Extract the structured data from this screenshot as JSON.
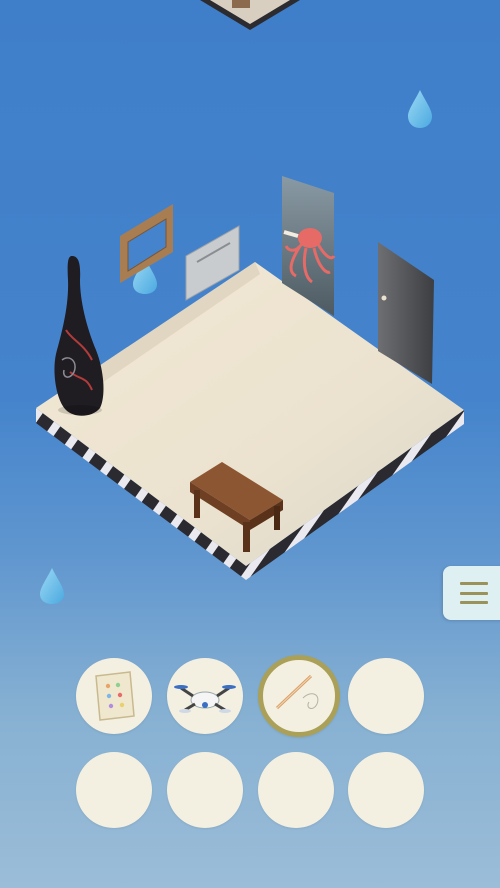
{
  "scene": {
    "background_top": "#3f7ec9",
    "background_bottom": "#9bbdd8",
    "items": [
      "vase",
      "frame",
      "vent",
      "octopus-poster",
      "door",
      "table",
      "water-drop"
    ]
  },
  "menu": {
    "icon": "hamburger-menu-icon",
    "color": "#9a9258"
  },
  "inventory": {
    "selected_index": 2,
    "slots": [
      {
        "item": "tablet-icon"
      },
      {
        "item": "drone-icon"
      },
      {
        "item": "wire-icon"
      },
      {
        "item": ""
      },
      {
        "item": ""
      },
      {
        "item": ""
      },
      {
        "item": ""
      },
      {
        "item": ""
      }
    ]
  }
}
